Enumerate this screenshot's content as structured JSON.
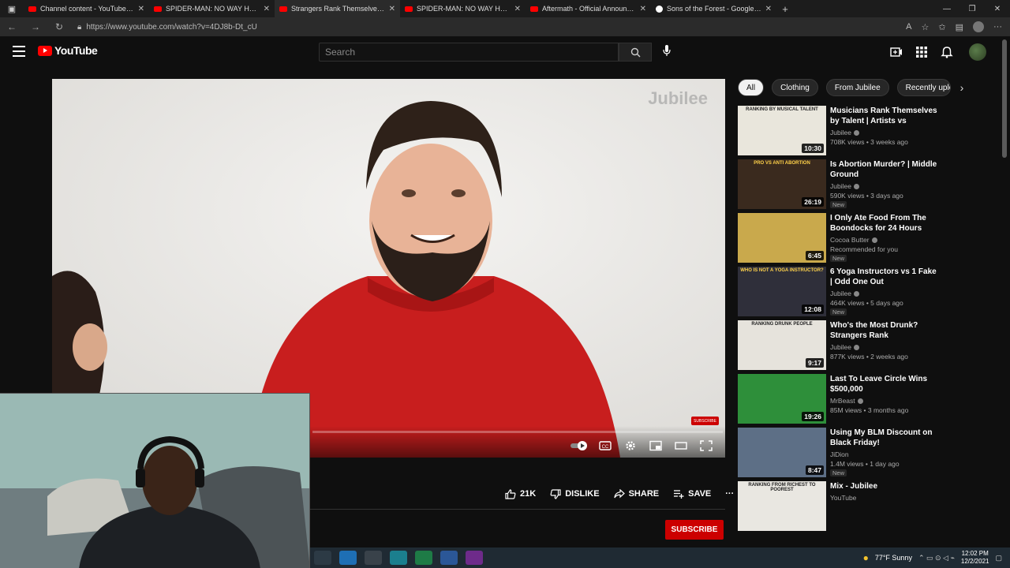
{
  "browser": {
    "tabs": [
      {
        "title": "Channel content - YouTube Studio",
        "active": false,
        "favicon": "youtube"
      },
      {
        "title": "SPIDER-MAN: NO WAY HOME (2021)",
        "active": false,
        "favicon": "youtube"
      },
      {
        "title": "Strangers Rank Themselves Richest",
        "active": true,
        "favicon": "youtube"
      },
      {
        "title": "SPIDER-MAN: NO WAY HOME (2021)",
        "active": false,
        "favicon": "youtube"
      },
      {
        "title": "Aftermath - Official Announcement",
        "active": false,
        "favicon": "youtube"
      },
      {
        "title": "Sons of the Forest - Google Search",
        "active": false,
        "favicon": "google"
      }
    ],
    "url": "https://www.youtube.com/watch?v=4DJ8b-Dt_cU"
  },
  "header": {
    "logo_text": "YouTube",
    "search_placeholder": "Search"
  },
  "player": {
    "watermark": "Jubilee",
    "subscribe_overlay": "SUBSCRIBE",
    "progress": 0.0
  },
  "actions": {
    "like_count": "21K",
    "dislike_label": "DISLIKE",
    "share_label": "SHARE",
    "save_label": "SAVE",
    "more": "···"
  },
  "subscribe_label": "SUBSCRIBE",
  "chips": [
    "All",
    "Clothing",
    "From Jubilee",
    "Recently uploaded"
  ],
  "recs": [
    {
      "title": "Musicians Rank Themselves by Talent | Artists vs Audience",
      "channel": "Jubilee",
      "verified": true,
      "views": "708K views • 3 weeks ago",
      "duration": "10:30",
      "new": false,
      "thumb_caption": "RANKING BY MUSICAL TALENT",
      "thumb_color": "#e9e6dc"
    },
    {
      "title": "Is Abortion Murder? | Middle Ground",
      "channel": "Jubilee",
      "verified": true,
      "views": "590K views • 3 days ago",
      "duration": "26:19",
      "new": true,
      "thumb_caption": "PRO VS ANTI ABORTION",
      "thumb_color": "#3a2a1e"
    },
    {
      "title": "I Only Ate Food From The Boondocks for 24 Hours",
      "channel": "Cocoa Butter",
      "verified": true,
      "views": "Recommended for you",
      "duration": "6:45",
      "new": true,
      "thumb_caption": "",
      "thumb_color": "#c9a94c"
    },
    {
      "title": "6 Yoga Instructors vs 1 Fake | Odd One Out",
      "channel": "Jubilee",
      "verified": true,
      "views": "464K views • 5 days ago",
      "duration": "12:08",
      "new": true,
      "thumb_caption": "WHO IS NOT A YOGA INSTRUCTOR?",
      "thumb_color": "#2f2f3a"
    },
    {
      "title": "Who's the Most Drunk? Strangers Rank Themselves...",
      "channel": "Jubilee",
      "verified": true,
      "views": "877K views • 2 weeks ago",
      "duration": "9:17",
      "new": false,
      "thumb_caption": "RANKING DRUNK PEOPLE",
      "thumb_color": "#e6e3dc"
    },
    {
      "title": "Last To Leave Circle Wins $500,000",
      "channel": "MrBeast",
      "verified": true,
      "views": "85M views • 3 months ago",
      "duration": "19:26",
      "new": false,
      "thumb_caption": "",
      "thumb_color": "#2e8f3a"
    },
    {
      "title": "Using My BLM Discount on Black Friday!",
      "channel": "JiDion",
      "verified": false,
      "views": "1.4M views • 1 day ago",
      "duration": "8:47",
      "new": true,
      "thumb_caption": "",
      "thumb_color": "#5d6f86"
    },
    {
      "title": "Mix - Jubilee",
      "channel": "YouTube",
      "verified": false,
      "views": "",
      "duration": "",
      "new": false,
      "thumb_caption": "RANKING FROM RICHEST TO POOREST",
      "thumb_color": "#e9e7e1"
    }
  ],
  "new_badge": "New",
  "taskbar": {
    "weather": "77°F  Sunny",
    "time": "12:02 PM",
    "date": "12/2/2021"
  }
}
